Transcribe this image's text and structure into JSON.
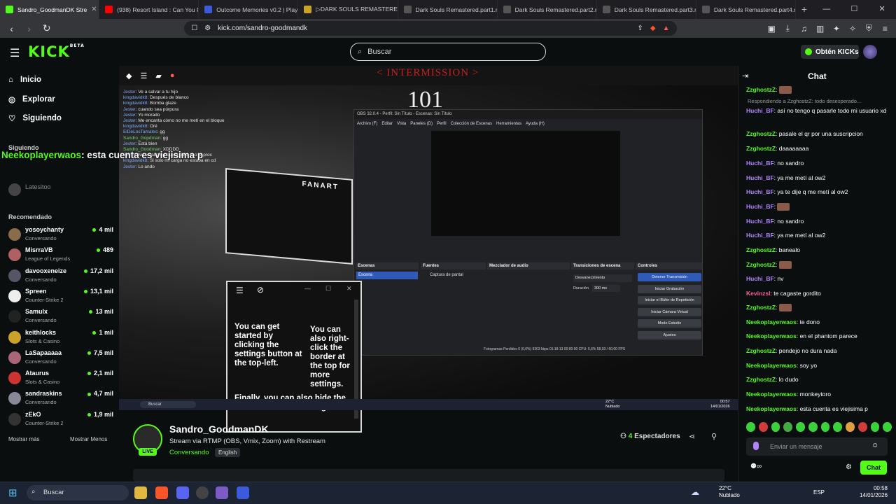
{
  "browser": {
    "tabs": [
      {
        "label": "Sandro_GoodmanDK Stre",
        "color": "#53fc18",
        "active": true
      },
      {
        "label": "(938) Resort Island : Can You Fa",
        "color": "#ff0000"
      },
      {
        "label": "Outcome Memories v0.2 | Play",
        "color": "#3b5bdb"
      },
      {
        "label": "▷DARK SOULS REMASTERED ",
        "color": "#c9a227"
      },
      {
        "label": "Dark Souls Remastered.part1.r",
        "color": "#555"
      },
      {
        "label": "Dark Souls Remastered.part2.r",
        "color": "#555"
      },
      {
        "label": "Dark Souls Remastered.part3.r",
        "color": "#555"
      },
      {
        "label": "Dark Souls Remastered.part4.r",
        "color": "#555"
      }
    ],
    "url": "kick.com/sandro-goodmandk"
  },
  "header": {
    "logo": "KICK",
    "logo_sup": "BETA",
    "search_placeholder": "Buscar",
    "kicks_button": "Obtén KICKs"
  },
  "sidebar": {
    "nav": [
      {
        "label": "Inicio",
        "icon": "home-icon"
      },
      {
        "label": "Explorar",
        "icon": "compass-icon"
      },
      {
        "label": "Siguiendo",
        "icon": "heart-icon"
      }
    ],
    "following_heading": "Siguiendo",
    "following": [
      {
        "name": "Latesitoo"
      }
    ],
    "recommended_heading": "Recomendado",
    "recommended": [
      {
        "name": "yosoychanty",
        "category": "Conversando",
        "viewers": "4 mil",
        "color": "#8a6b4a"
      },
      {
        "name": "MisrraVB",
        "category": "League of Legends",
        "viewers": "489",
        "color": "#b06060"
      },
      {
        "name": "davooxeneize",
        "category": "Conversando",
        "viewers": "17,2 mil",
        "color": "#556"
      },
      {
        "name": "Spreen",
        "category": "Counter-Strike 2",
        "viewers": "13,1 mil",
        "color": "#eee"
      },
      {
        "name": "Samulx",
        "category": "Conversando",
        "viewers": "13 mil",
        "color": "#222"
      },
      {
        "name": "keithlocks",
        "category": "Slots & Casino",
        "viewers": "1 mil",
        "color": "#c9a227"
      },
      {
        "name": "LaSapaaaaa",
        "category": "Conversando",
        "viewers": "7,5 mil",
        "color": "#a67"
      },
      {
        "name": "Ataurus",
        "category": "Slots & Casino",
        "viewers": "2,1 mil",
        "color": "#c33"
      },
      {
        "name": "sandraskins",
        "category": "Conversando",
        "viewers": "4,7 mil",
        "color": "#889"
      },
      {
        "name": "zEkO",
        "category": "Counter-Strike 2",
        "viewers": "1,9 mil",
        "color": "#333"
      }
    ],
    "show_more": "Mostrar más",
    "show_less": "Mostrar Menos"
  },
  "player": {
    "intermission": "< INTERMISSION >",
    "big_number": "101",
    "overlay_name": "Neekoplayerwaos",
    "overlay_text": ": esta cuenta es viejisima p",
    "overlay_chat": [
      {
        "user": "Jester",
        "text": "Ve a salvar a tu hijo"
      },
      {
        "user": "kingdavidk8",
        "text": "Después de blanco"
      },
      {
        "user": "kingdavidk8",
        "text": "Bomba glaze"
      },
      {
        "user": "Jester",
        "text": "cuando sea púrpura"
      },
      {
        "user": "Jester",
        "text": "Yo morado"
      },
      {
        "user": "Jester",
        "text": "Me encanta cómo no me metí en el bloque"
      },
      {
        "user": "kingdavidk8",
        "text": "Oré"
      },
      {
        "user": "ElDeLosTamales",
        "text": "gg"
      },
      {
        "user": "Sandro_Gopdman",
        "text": "gg"
      },
      {
        "user": "Jester",
        "text": "Está bien"
      },
      {
        "user": "Sandro_Goodman",
        "text": "XDDDD"
      },
      {
        "user": "Jester",
        "text": "No estaba en rango para eso al proc"
      },
      {
        "user": "kingdavidk8",
        "text": "Si solo mi carga no estaba en cd"
      },
      {
        "user": "Jester",
        "text": "Lo ando"
      }
    ],
    "fanart_title": "FANART",
    "obs": {
      "title": "OBS 32.0.4 - Perfil: Sin Título - Escenas: Sin Título",
      "menu": [
        "Archivo (F)",
        "Editar",
        "Vista",
        "Paneles (D)",
        "Perfil",
        "Colección de Escenas",
        "Herramientas",
        "Ayuda (H)"
      ],
      "panels": [
        "Escenas",
        "Fuentes",
        "Mezclador de audio",
        "Transiciones de escena",
        "Controles"
      ],
      "scene": "Escena",
      "source": "Captura de pantal",
      "controls": [
        "Detener Transmisión",
        "Iniciar Grabación",
        "Iniciar el Búfer de Repetición",
        "Iniciar Cámara Virtual",
        "Modo Estudio",
        "Ajustes"
      ],
      "transition": "Desvanecimiento",
      "duration_label": "Duración",
      "duration": "300 ms",
      "status": "Fotogramas Perdidos 0 (0,0%)   9303 kbps   01:18:13   00:00:00   CPU: 5,6%   58,03 / 60,00 FPS"
    },
    "help": {
      "text1": "You can get started by clicking the settings button at the top-left.",
      "text2": "You can also right-click the border at the top for more settings.",
      "text3": "Finally, you can also hide the borders or show settings"
    },
    "inner_taskbar": {
      "search": "Buscar",
      "temp": "22°C",
      "weather": "Nublado",
      "time": "00:57",
      "date": "14/01/2026"
    }
  },
  "stream": {
    "streamer": "Sandro_GoodmanDK",
    "title": "Stream via RTMP (OBS, Vmix, Zoom) with Restream",
    "category": "Conversando",
    "language": "English",
    "viewers_count": "4",
    "viewers_label": "Espectadores",
    "live": "LIVE"
  },
  "chat": {
    "title": "Chat",
    "reply_note": "Respondiendo a ZzghostzZ: todo desesperado...",
    "messages": [
      {
        "user": "ZzghostzZ",
        "text": "",
        "cls": "c-z"
      },
      {
        "user": "Huchi_BF",
        "text": "así no tengo q pasarle todo mi usuario xd",
        "cls": "c-h"
      },
      {
        "user": "ZzghostzZ",
        "text": "pasale el qr por una suscripcion",
        "cls": "c-z"
      },
      {
        "user": "ZzghostzZ",
        "text": "daaaaaaaa",
        "cls": "c-z"
      },
      {
        "user": "Huchi_BF",
        "text": "no sandro",
        "cls": "c-h"
      },
      {
        "user": "Huchi_BF",
        "text": "ya me metí al ow2",
        "cls": "c-h"
      },
      {
        "user": "Huchi_BF",
        "text": "ya te dije q me metí al ow2",
        "cls": "c-h"
      },
      {
        "user": "Huchi_BF",
        "text": "",
        "cls": "c-h"
      },
      {
        "user": "Huchi_BF",
        "text": "no sandro",
        "cls": "c-h"
      },
      {
        "user": "Huchi_BF",
        "text": "ya me metí al ow2",
        "cls": "c-h"
      },
      {
        "user": "ZzghostzZ",
        "text": "banealo",
        "cls": "c-z"
      },
      {
        "user": "ZzghostzZ",
        "text": "",
        "cls": "c-z"
      },
      {
        "user": "Huchi_BF",
        "text": "nv",
        "cls": "c-h"
      },
      {
        "user": "Kevinzsl",
        "text": "te cagaste gordito",
        "cls": "c-k"
      },
      {
        "user": "ZzghostzZ",
        "text": "",
        "cls": "c-z"
      },
      {
        "user": "Neekoplayerwaos",
        "text": "te dono",
        "cls": "c-n"
      },
      {
        "user": "Neekoplayerwaos",
        "text": "en el phantom parece",
        "cls": "c-n"
      },
      {
        "user": "ZzghostzZ",
        "text": "pendejo no dura nada",
        "cls": "c-z"
      },
      {
        "user": "Neekoplayerwaos",
        "text": "soy yo",
        "cls": "c-n"
      },
      {
        "user": "ZzghostzZ",
        "text": "lo dudo",
        "cls": "c-z"
      },
      {
        "user": "Neekoplayerwaos",
        "text": "monkeytoro",
        "cls": "c-n"
      },
      {
        "user": "Neekoplayerwaos",
        "text": "esta cuenta es viejisima p",
        "cls": "c-n"
      }
    ],
    "input_placeholder": "Enviar un mensaje",
    "send_button": "Chat"
  },
  "taskbar": {
    "search": "Buscar",
    "temp": "22°C",
    "weather": "Nublado",
    "lang": "ESP",
    "time": "00:58",
    "date": "14/01/2026"
  }
}
